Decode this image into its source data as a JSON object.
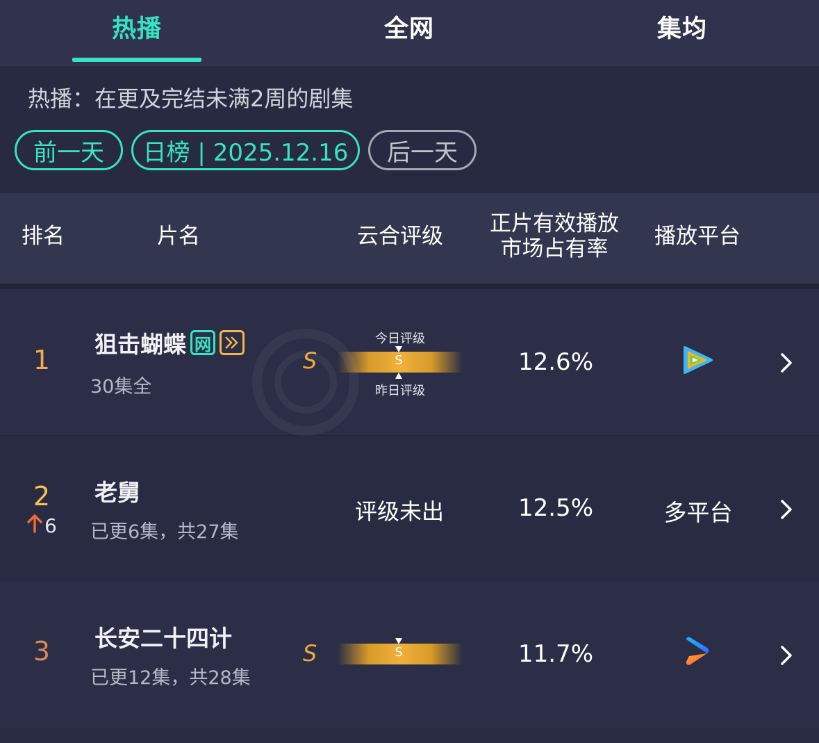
{
  "tabs": [
    {
      "label": "热播"
    },
    {
      "label": "全网"
    },
    {
      "label": "集均"
    }
  ],
  "info": {
    "description": "热播：在更及完结未满2周的剧集",
    "prev_day": "前一天",
    "date_label": "日榜 | 2025.12.16",
    "next_day": "后一天"
  },
  "table": {
    "headers": {
      "rank": "排名",
      "title": "片名",
      "rating": "云合评级",
      "share_line1": "正片有效播放",
      "share_line2": "市场占有率",
      "platform": "播放平台"
    },
    "rows": [
      {
        "rank": "1",
        "title": "狙击蝴蝶",
        "tag_net": "网",
        "tag_ff": "»",
        "subtitle": "30集全",
        "grade": "S",
        "grade_mark": "S",
        "grade_today": "今日评级",
        "grade_yesterday": "昨日评级",
        "share": "12.6%",
        "platform_icon": "tencent-video-icon"
      },
      {
        "rank": "2",
        "rank_change": "6",
        "title": "老舅",
        "subtitle": "已更6集，共27集",
        "grade_text": "评级未出",
        "share": "12.5%",
        "platform": "多平台"
      },
      {
        "rank": "3",
        "title": "长安二十四计",
        "subtitle": "已更12集，共28集",
        "grade": "S",
        "grade_mark": "S",
        "share": "11.7%",
        "platform_icon": "youku-icon"
      }
    ]
  },
  "colors": {
    "accent": "#36e4c2",
    "gold": "#f0a83a",
    "background": "#22243a"
  }
}
